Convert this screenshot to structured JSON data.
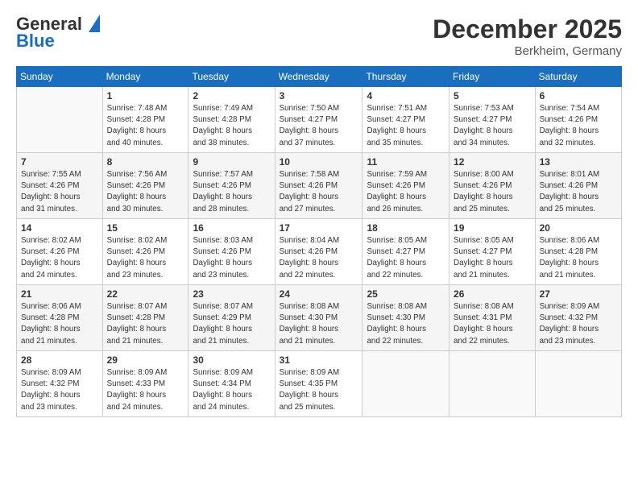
{
  "header": {
    "logo_line1": "General",
    "logo_line2": "Blue",
    "title": "December 2025",
    "location": "Berkheim, Germany"
  },
  "weekdays": [
    "Sunday",
    "Monday",
    "Tuesday",
    "Wednesday",
    "Thursday",
    "Friday",
    "Saturday"
  ],
  "weeks": [
    [
      {
        "day": "",
        "info": ""
      },
      {
        "day": "1",
        "info": "Sunrise: 7:48 AM\nSunset: 4:28 PM\nDaylight: 8 hours\nand 40 minutes."
      },
      {
        "day": "2",
        "info": "Sunrise: 7:49 AM\nSunset: 4:28 PM\nDaylight: 8 hours\nand 38 minutes."
      },
      {
        "day": "3",
        "info": "Sunrise: 7:50 AM\nSunset: 4:27 PM\nDaylight: 8 hours\nand 37 minutes."
      },
      {
        "day": "4",
        "info": "Sunrise: 7:51 AM\nSunset: 4:27 PM\nDaylight: 8 hours\nand 35 minutes."
      },
      {
        "day": "5",
        "info": "Sunrise: 7:53 AM\nSunset: 4:27 PM\nDaylight: 8 hours\nand 34 minutes."
      },
      {
        "day": "6",
        "info": "Sunrise: 7:54 AM\nSunset: 4:26 PM\nDaylight: 8 hours\nand 32 minutes."
      }
    ],
    [
      {
        "day": "7",
        "info": "Sunrise: 7:55 AM\nSunset: 4:26 PM\nDaylight: 8 hours\nand 31 minutes."
      },
      {
        "day": "8",
        "info": "Sunrise: 7:56 AM\nSunset: 4:26 PM\nDaylight: 8 hours\nand 30 minutes."
      },
      {
        "day": "9",
        "info": "Sunrise: 7:57 AM\nSunset: 4:26 PM\nDaylight: 8 hours\nand 28 minutes."
      },
      {
        "day": "10",
        "info": "Sunrise: 7:58 AM\nSunset: 4:26 PM\nDaylight: 8 hours\nand 27 minutes."
      },
      {
        "day": "11",
        "info": "Sunrise: 7:59 AM\nSunset: 4:26 PM\nDaylight: 8 hours\nand 26 minutes."
      },
      {
        "day": "12",
        "info": "Sunrise: 8:00 AM\nSunset: 4:26 PM\nDaylight: 8 hours\nand 25 minutes."
      },
      {
        "day": "13",
        "info": "Sunrise: 8:01 AM\nSunset: 4:26 PM\nDaylight: 8 hours\nand 25 minutes."
      }
    ],
    [
      {
        "day": "14",
        "info": "Sunrise: 8:02 AM\nSunset: 4:26 PM\nDaylight: 8 hours\nand 24 minutes."
      },
      {
        "day": "15",
        "info": "Sunrise: 8:02 AM\nSunset: 4:26 PM\nDaylight: 8 hours\nand 23 minutes."
      },
      {
        "day": "16",
        "info": "Sunrise: 8:03 AM\nSunset: 4:26 PM\nDaylight: 8 hours\nand 23 minutes."
      },
      {
        "day": "17",
        "info": "Sunrise: 8:04 AM\nSunset: 4:26 PM\nDaylight: 8 hours\nand 22 minutes."
      },
      {
        "day": "18",
        "info": "Sunrise: 8:05 AM\nSunset: 4:27 PM\nDaylight: 8 hours\nand 22 minutes."
      },
      {
        "day": "19",
        "info": "Sunrise: 8:05 AM\nSunset: 4:27 PM\nDaylight: 8 hours\nand 21 minutes."
      },
      {
        "day": "20",
        "info": "Sunrise: 8:06 AM\nSunset: 4:28 PM\nDaylight: 8 hours\nand 21 minutes."
      }
    ],
    [
      {
        "day": "21",
        "info": "Sunrise: 8:06 AM\nSunset: 4:28 PM\nDaylight: 8 hours\nand 21 minutes."
      },
      {
        "day": "22",
        "info": "Sunrise: 8:07 AM\nSunset: 4:28 PM\nDaylight: 8 hours\nand 21 minutes."
      },
      {
        "day": "23",
        "info": "Sunrise: 8:07 AM\nSunset: 4:29 PM\nDaylight: 8 hours\nand 21 minutes."
      },
      {
        "day": "24",
        "info": "Sunrise: 8:08 AM\nSunset: 4:30 PM\nDaylight: 8 hours\nand 21 minutes."
      },
      {
        "day": "25",
        "info": "Sunrise: 8:08 AM\nSunset: 4:30 PM\nDaylight: 8 hours\nand 22 minutes."
      },
      {
        "day": "26",
        "info": "Sunrise: 8:08 AM\nSunset: 4:31 PM\nDaylight: 8 hours\nand 22 minutes."
      },
      {
        "day": "27",
        "info": "Sunrise: 8:09 AM\nSunset: 4:32 PM\nDaylight: 8 hours\nand 23 minutes."
      }
    ],
    [
      {
        "day": "28",
        "info": "Sunrise: 8:09 AM\nSunset: 4:32 PM\nDaylight: 8 hours\nand 23 minutes."
      },
      {
        "day": "29",
        "info": "Sunrise: 8:09 AM\nSunset: 4:33 PM\nDaylight: 8 hours\nand 24 minutes."
      },
      {
        "day": "30",
        "info": "Sunrise: 8:09 AM\nSunset: 4:34 PM\nDaylight: 8 hours\nand 24 minutes."
      },
      {
        "day": "31",
        "info": "Sunrise: 8:09 AM\nSunset: 4:35 PM\nDaylight: 8 hours\nand 25 minutes."
      },
      {
        "day": "",
        "info": ""
      },
      {
        "day": "",
        "info": ""
      },
      {
        "day": "",
        "info": ""
      }
    ]
  ]
}
